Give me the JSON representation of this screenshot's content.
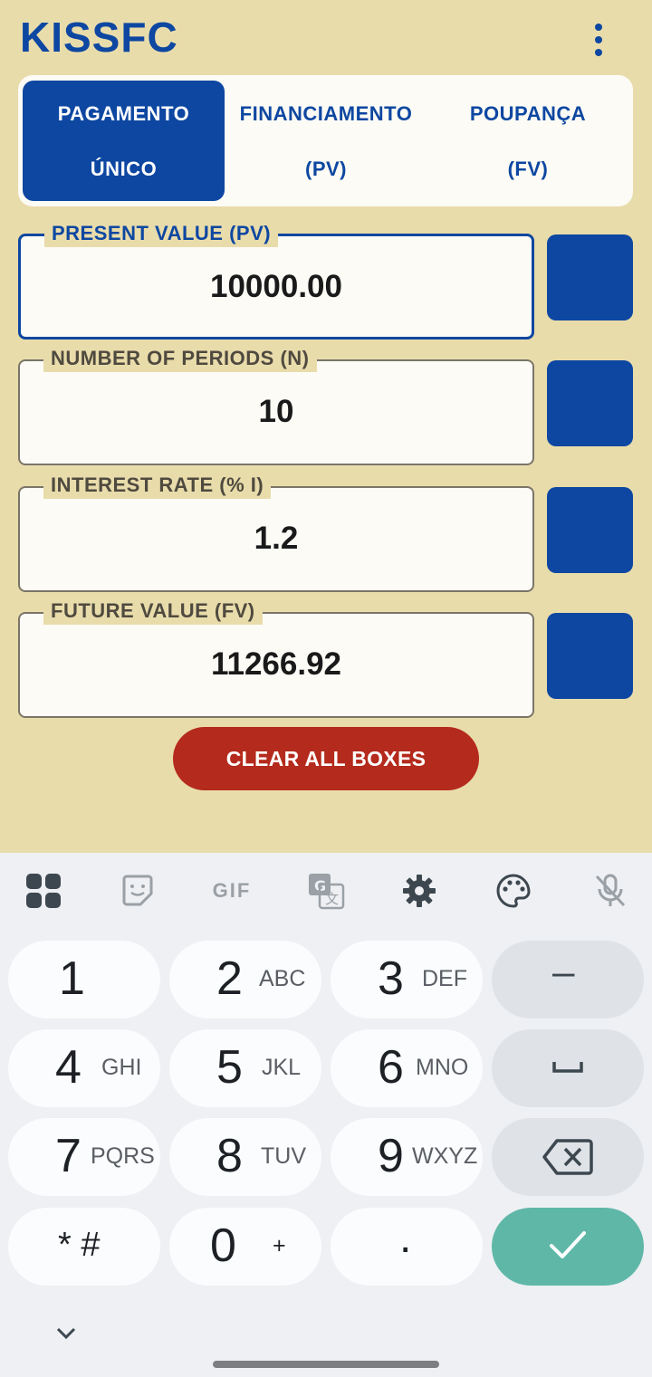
{
  "app": {
    "title": "KISSFC"
  },
  "tabs": [
    {
      "line1": "PAGAMENTO",
      "line2": "ÚNICO"
    },
    {
      "line1": "FINANCIAMENTO",
      "line2": "(PV)"
    },
    {
      "line1": "POUPANÇA",
      "line2": "(FV)"
    }
  ],
  "fields": [
    {
      "label": "PRESENT VALUE (PV)",
      "value": "10000.00"
    },
    {
      "label": "NUMBER OF PERIODS (N)",
      "value": "10"
    },
    {
      "label": "INTEREST RATE (% I)",
      "value": "1.2"
    },
    {
      "label": "FUTURE VALUE (FV)",
      "value": "11266.92"
    }
  ],
  "clear_button": {
    "label": "CLEAR ALL BOXES"
  },
  "keyboard": {
    "toolbar": {
      "gif_label": "GIF",
      "icons": [
        "apps-grid-icon",
        "sticker-icon",
        "gif-icon",
        "translate-icon",
        "settings-icon",
        "palette-icon",
        "mic-off-icon"
      ]
    },
    "keys": {
      "k1": {
        "num": "1",
        "letters": ""
      },
      "k2": {
        "num": "2",
        "letters": "ABC"
      },
      "k3": {
        "num": "3",
        "letters": "DEF"
      },
      "k4": {
        "num": "4",
        "letters": "GHI"
      },
      "k5": {
        "num": "5",
        "letters": "JKL"
      },
      "k6": {
        "num": "6",
        "letters": "MNO"
      },
      "k7": {
        "num": "7",
        "letters": "PQRS"
      },
      "k8": {
        "num": "8",
        "letters": "TUV"
      },
      "k9": {
        "num": "9",
        "letters": "WXYZ"
      },
      "k0": {
        "num": "0",
        "letters": "+"
      },
      "star": "* #",
      "dot": ".",
      "minus": "–"
    }
  },
  "colors": {
    "brand_blue": "#0d47a1",
    "background": "#e9dcab",
    "danger_red": "#b42a1c",
    "confirm_teal": "#5fb7a8"
  }
}
